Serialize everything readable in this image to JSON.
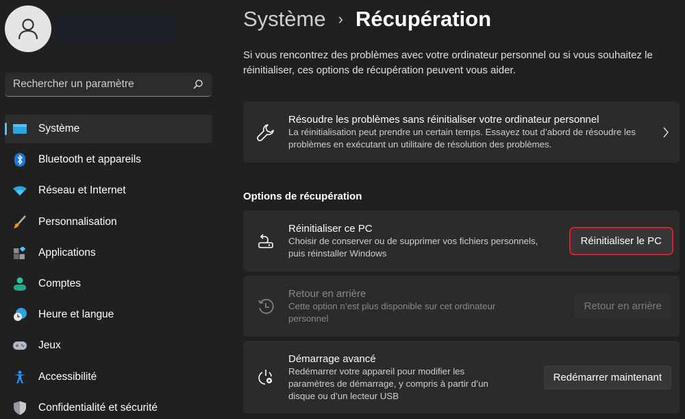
{
  "sidebar": {
    "search_placeholder": "Rechercher un paramètre",
    "items": [
      {
        "label": "Système",
        "icon": "monitor-icon",
        "active": true
      },
      {
        "label": "Bluetooth et appareils",
        "icon": "bluetooth-icon"
      },
      {
        "label": "Réseau et Internet",
        "icon": "wifi-icon"
      },
      {
        "label": "Personnalisation",
        "icon": "paintbrush-icon"
      },
      {
        "label": "Applications",
        "icon": "apps-icon"
      },
      {
        "label": "Comptes",
        "icon": "person-icon"
      },
      {
        "label": "Heure et langue",
        "icon": "globe-clock-icon"
      },
      {
        "label": "Jeux",
        "icon": "gamepad-icon"
      },
      {
        "label": "Accessibilité",
        "icon": "accessibility-icon"
      },
      {
        "label": "Confidentialité et sécurité",
        "icon": "shield-icon"
      }
    ]
  },
  "header": {
    "breadcrumb_parent": "Système",
    "breadcrumb_separator": "›",
    "breadcrumb_current": "Récupération",
    "intro": "Si vous rencontrez des problèmes avec votre ordinateur personnel ou si vous souhaitez le réinitialiser, ces options de récupération peuvent vous aider."
  },
  "troubleshoot": {
    "title": "Résoudre les problèmes sans réinitialiser votre ordinateur personnel",
    "description": "La réinitialisation peut prendre un certain temps. Essayez tout d’abord de résoudre les problèmes en exécutant un utilitaire de résolution des problèmes."
  },
  "section_title": "Options de récupération",
  "options": [
    {
      "title": "Réinitialiser ce PC",
      "description": "Choisir de conserver ou de supprimer vos fichiers personnels, puis réinstaller Windows",
      "button": "Réinitialiser le PC",
      "enabled": true,
      "highlighted": true
    },
    {
      "title": "Retour en arrière",
      "description": "Cette option n’est plus disponible sur cet ordinateur personnel",
      "button": "Retour en arrière",
      "enabled": false
    },
    {
      "title": "Démarrage avancé",
      "description": "Redémarrer votre appareil pour modifier les paramètres de démarrage, y compris à partir d’un disque ou d’un lecteur USB",
      "button": "Redémarrer maintenant",
      "enabled": true
    }
  ],
  "colors": {
    "accent": "#4cc2ff",
    "highlight_border": "#e0202e",
    "background": "#202020",
    "card": "#2b2b2b"
  }
}
